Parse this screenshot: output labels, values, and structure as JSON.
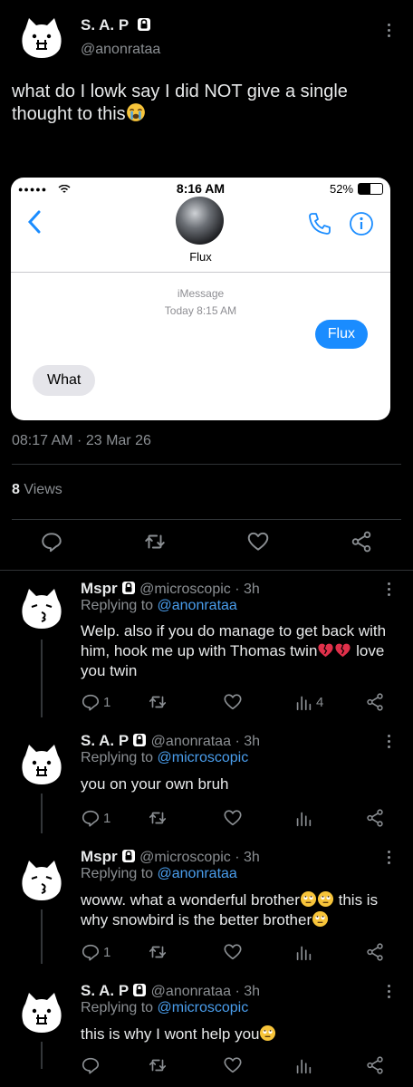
{
  "tweet": {
    "author_name": "S. A. P",
    "author_handle": "@anonrataa",
    "text": "what do I lowk say I did NOT give a single thought to this",
    "timestamp": "08:17 AM · 23 Mar 26",
    "views_count": "8",
    "views_label": "Views"
  },
  "embedded_screenshot": {
    "time": "8:16 AM",
    "battery": "52%",
    "contact_name": "Flux",
    "service_label": "iMessage",
    "date_label": "Today 8:15 AM",
    "outgoing_message": "Flux",
    "incoming_message": "What"
  },
  "replies": [
    {
      "name": "Mspr",
      "handle": "@microscopic",
      "time": "· 3h",
      "replying_prefix": "Replying to",
      "replying_to": "@anonrataa",
      "text_a": "Welp. also if you do manage to get back with him, hook me up with Thomas twin",
      "text_b": " love you twin",
      "reply_count": "1",
      "view_count": "4"
    },
    {
      "name": "S. A. P",
      "handle": "@anonrataa",
      "time": "· 3h",
      "replying_prefix": "Replying to",
      "replying_to": "@microscopic",
      "text_a": "you on your own bruh",
      "reply_count": "1"
    },
    {
      "name": "Mspr",
      "handle": "@microscopic",
      "time": "· 3h",
      "replying_prefix": "Replying to",
      "replying_to": "@anonrataa",
      "text_a": "woww. what a wonderful brother",
      "text_b": " this is why snowbird is the better brother",
      "reply_count": "1"
    },
    {
      "name": "S. A. P",
      "handle": "@anonrataa",
      "time": "· 3h",
      "replying_prefix": "Replying to",
      "replying_to": "@microscopic",
      "text_a": "this is why I wont help you"
    }
  ],
  "icons": {
    "lock": "lock-icon",
    "reply": "reply-icon",
    "retweet": "retweet-icon",
    "like": "like-icon",
    "share": "share-icon",
    "views": "views-icon",
    "more": "more-icon"
  },
  "colors": {
    "background": "#000000",
    "link": "#4a9eed",
    "muted": "#8b8f93",
    "imessage_blue": "#1a8cff",
    "incoming_bubble": "#e5e5ea"
  }
}
